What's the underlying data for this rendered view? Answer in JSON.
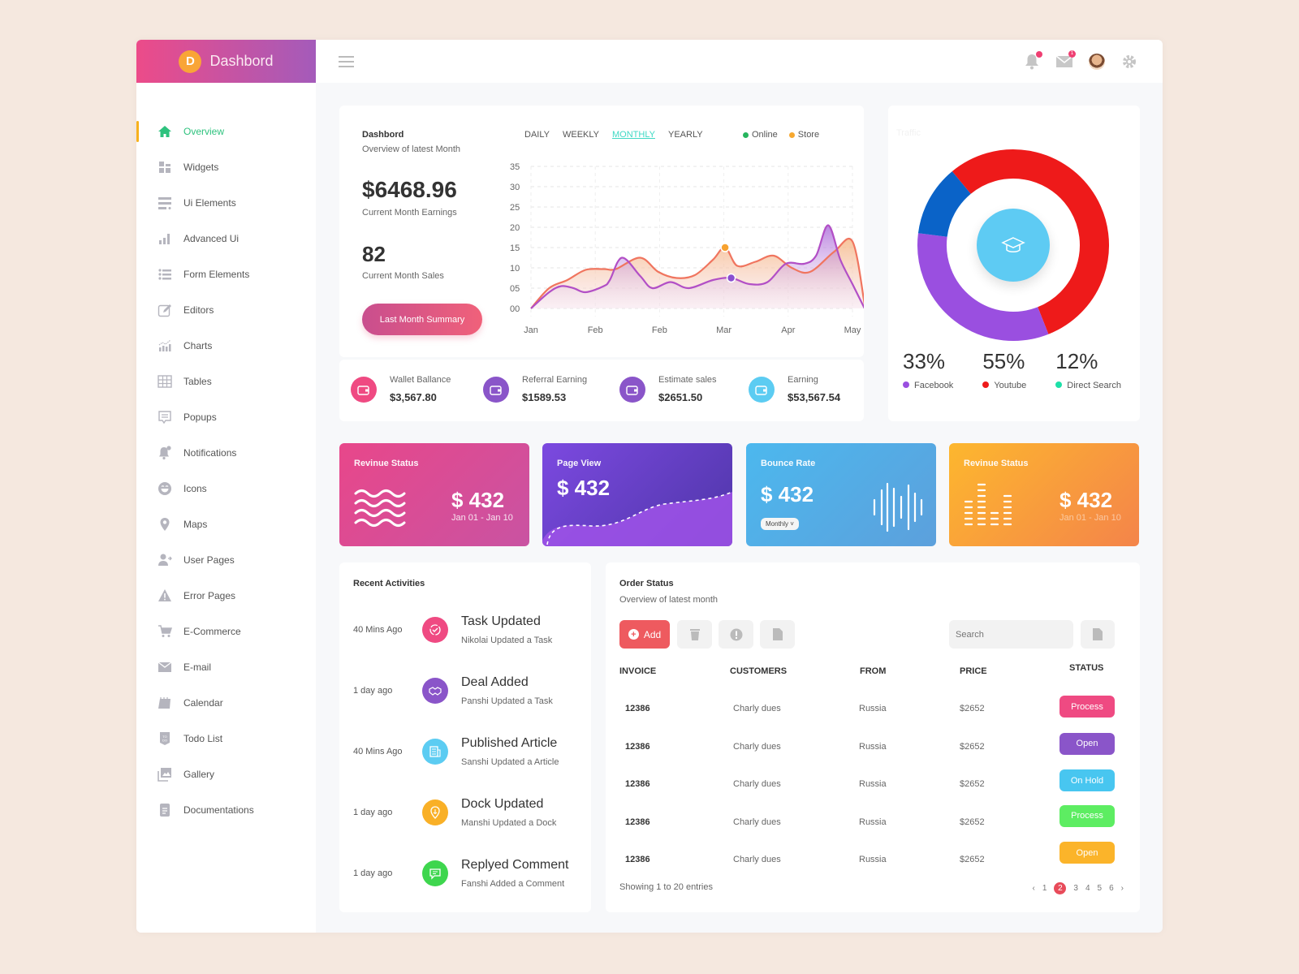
{
  "brand": {
    "logo_letter": "D",
    "title": "Dashbord"
  },
  "sidebar": {
    "items": [
      {
        "label": "Overview",
        "icon": "home-icon",
        "active": true
      },
      {
        "label": "Widgets",
        "icon": "widgets-icon"
      },
      {
        "label": "Ui Elements",
        "icon": "ui-elements-icon"
      },
      {
        "label": "Advanced Ui",
        "icon": "bar-chart-icon"
      },
      {
        "label": "Form Elements",
        "icon": "list-icon"
      },
      {
        "label": "Editors",
        "icon": "edit-icon"
      },
      {
        "label": "Charts",
        "icon": "charts-icon"
      },
      {
        "label": "Tables",
        "icon": "table-icon"
      },
      {
        "label": "Popups",
        "icon": "popup-icon"
      },
      {
        "label": "Notifications",
        "icon": "bell-icon"
      },
      {
        "label": "Icons",
        "icon": "smiley-icon"
      },
      {
        "label": "Maps",
        "icon": "map-pin-icon"
      },
      {
        "label": "User Pages",
        "icon": "user-icon"
      },
      {
        "label": "Error Pages",
        "icon": "warning-icon"
      },
      {
        "label": "E-Commerce",
        "icon": "cart-icon"
      },
      {
        "label": "E-mail",
        "icon": "mail-icon"
      },
      {
        "label": "Calendar",
        "icon": "calendar-icon"
      },
      {
        "label": "Todo List",
        "icon": "todo-icon"
      },
      {
        "label": "Gallery",
        "icon": "gallery-icon"
      },
      {
        "label": "Documentations",
        "icon": "document-icon"
      }
    ]
  },
  "topbar": {
    "icons": [
      "menu-icon",
      "bell-icon",
      "mail-icon",
      "avatar",
      "gear-icon"
    ],
    "mail_badge": "1"
  },
  "overview": {
    "title": "Dashbord",
    "subtitle": "Overview of latest Month",
    "earnings_value": "$6468.96",
    "earnings_label": "Current Month Earnings",
    "sales_value": "82",
    "sales_label": "Current Month Sales",
    "summary_button": "Last Month Summary",
    "tabs": [
      "DAILY",
      "WEEKLY",
      "MONTHLY",
      "YEARLY"
    ],
    "active_tab": "MONTHLY"
  },
  "chart_data": [
    {
      "type": "area",
      "title": "",
      "xlabel": "",
      "ylabel": "",
      "x": [
        "Jan",
        "Feb",
        "Feb",
        "Mar",
        "Apr",
        "May"
      ],
      "y_ticks": [
        "00",
        "05",
        "10",
        "15",
        "20",
        "25",
        "30",
        "35"
      ],
      "ylim": [
        0,
        35
      ],
      "grid": true,
      "legend": {
        "position": "top-right",
        "entries": [
          {
            "name": "Online",
            "color": "#27b55e"
          },
          {
            "name": "Store",
            "color": "#f7a830"
          }
        ]
      },
      "series": [
        {
          "name": "Store",
          "color": "#f39a5a",
          "points": [
            [
              0,
              0
            ],
            [
              0.3,
              5
            ],
            [
              0.6,
              7
            ],
            [
              0.9,
              9.5
            ],
            [
              1.2,
              9.7
            ],
            [
              1.4,
              9.7
            ],
            [
              1.8,
              12.5
            ],
            [
              2.1,
              9
            ],
            [
              2.4,
              7.5
            ],
            [
              2.7,
              8.2
            ],
            [
              3.0,
              12
            ],
            [
              3.2,
              15
            ],
            [
              3.4,
              10.5
            ],
            [
              3.7,
              11.5
            ],
            [
              4.0,
              13
            ],
            [
              4.3,
              10
            ],
            [
              4.6,
              9
            ],
            [
              5.0,
              14
            ],
            [
              5.3,
              16.5
            ],
            [
              5.5,
              1
            ]
          ]
        },
        {
          "name": "Online",
          "color": "#a34fd0",
          "points": [
            [
              0,
              0
            ],
            [
              0.3,
              4
            ],
            [
              0.5,
              5.5
            ],
            [
              0.7,
              5
            ],
            [
              0.9,
              4
            ],
            [
              1.2,
              5.5
            ],
            [
              1.3,
              7
            ],
            [
              1.5,
              12.5
            ],
            [
              1.8,
              8
            ],
            [
              2.0,
              5
            ],
            [
              2.3,
              6.5
            ],
            [
              2.6,
              5
            ],
            [
              3.0,
              7
            ],
            [
              3.3,
              7.5
            ],
            [
              3.6,
              6
            ],
            [
              3.9,
              6.5
            ],
            [
              4.2,
              11
            ],
            [
              4.5,
              11
            ],
            [
              4.7,
              13
            ],
            [
              4.9,
              20.5
            ],
            [
              5.1,
              12
            ],
            [
              5.3,
              6
            ],
            [
              5.5,
              0
            ]
          ]
        }
      ],
      "highlight_points": [
        {
          "series": "Store",
          "x": 3.2,
          "y": 15
        },
        {
          "series": "Online",
          "x": 3.3,
          "y": 7.5
        }
      ]
    },
    {
      "type": "pie",
      "title": "Traffic",
      "slices": [
        {
          "label": "Facebook",
          "value": 33,
          "color": "#9a4fe0"
        },
        {
          "label": "Youtube",
          "value": 55,
          "color": "#ee1a1a"
        },
        {
          "label": "Direct Search",
          "value": 12,
          "color": "#0a63c8"
        }
      ],
      "legend_colors": {
        "Facebook": "#9a4fe0",
        "Youtube": "#ee1a1a",
        "Direct Search": "#1de0a8"
      },
      "center_icon": "graduation-cap-icon"
    }
  ],
  "traffic": {
    "title": "Traffic",
    "stats": [
      {
        "value": "33%",
        "label": "Facebook",
        "color": "#9a4fe0"
      },
      {
        "value": "55%",
        "label": "Youtube",
        "color": "#ee1a1a"
      },
      {
        "value": "12%",
        "label": "Direct Search",
        "color": "#1de0a8"
      }
    ]
  },
  "stats": [
    {
      "label": "Wallet Ballance",
      "value": "$3,567.80",
      "color": "#ef4a82",
      "icon": "wallet-icon"
    },
    {
      "label": "Referral Earning",
      "value": "$1589.53",
      "color": "#8a55c9",
      "icon": "wallet-icon"
    },
    {
      "label": "Estimate sales",
      "value": "$2651.50",
      "color": "#8a55c9",
      "icon": "wallet-icon"
    },
    {
      "label": "Earning",
      "value": "$53,567.54",
      "color": "#5cccf2",
      "icon": "wallet-icon"
    }
  ],
  "tiles": [
    {
      "title": "Revinue Status",
      "value": "$ 432",
      "sub": "Jan 01 - Jan 10",
      "icon": "waves-icon"
    },
    {
      "title": "Page View",
      "value": "$ 432",
      "icon": "trend-line-icon"
    },
    {
      "title": "Bounce Rate",
      "value": "$ 432",
      "select": "Monthly",
      "icon": "sound-wave-icon"
    },
    {
      "title": "Revinue Status",
      "value": "$ 432",
      "sub": "Jan 01 - Jan 10",
      "icon": "equalizer-icon"
    }
  ],
  "activities": {
    "title": "Recent Activities",
    "items": [
      {
        "time": "40 Mins Ago",
        "title": "Task Updated",
        "desc": "Nikolai Updated a Task",
        "color": "#ef4a82",
        "icon": "refresh-check-icon"
      },
      {
        "time": "1 day ago",
        "title": "Deal Added",
        "desc": "Panshi Updated a Task",
        "color": "#8a55c9",
        "icon": "handshake-icon"
      },
      {
        "time": "40 Mins Ago",
        "title": "Published Article",
        "desc": "Sanshi Updated a Article",
        "color": "#5cccf2",
        "icon": "newspaper-icon"
      },
      {
        "time": "1 day ago",
        "title": "Dock Updated",
        "desc": "Manshi Updated a Dock",
        "color": "#f9b027",
        "icon": "anchor-icon"
      },
      {
        "time": "1 day ago",
        "title": "Replyed Comment",
        "desc": "Fanshi Added a Comment",
        "color": "#3ed64e",
        "icon": "comment-icon"
      }
    ]
  },
  "orders": {
    "title": "Order Status",
    "subtitle": "Overview of latest month",
    "add_label": "Add",
    "search_placeholder": "Search",
    "columns": [
      "INVOICE",
      "CUSTOMERS",
      "FROM",
      "PRICE",
      "STATUS"
    ],
    "rows": [
      {
        "invoice": "12386",
        "customer": "Charly dues",
        "from": "Russia",
        "price": "$2652",
        "status": "Process",
        "color": "#ef4a82"
      },
      {
        "invoice": "12386",
        "customer": "Charly dues",
        "from": "Russia",
        "price": "$2652",
        "status": "Open",
        "color": "#8a55c9"
      },
      {
        "invoice": "12386",
        "customer": "Charly dues",
        "from": "Russia",
        "price": "$2652",
        "status": "On Hold",
        "color": "#48c6f0"
      },
      {
        "invoice": "12386",
        "customer": "Charly dues",
        "from": "Russia",
        "price": "$2652",
        "status": "Process",
        "color": "#5ded62"
      },
      {
        "invoice": "12386",
        "customer": "Charly dues",
        "from": "Russia",
        "price": "$2652",
        "status": "Open",
        "color": "#fbb42a"
      }
    ],
    "footer": "Showing 1 to 20 entries",
    "pages": [
      "1",
      "2",
      "3",
      "4",
      "5",
      "6"
    ],
    "current_page": "2",
    "prev": "‹",
    "next": "›"
  }
}
